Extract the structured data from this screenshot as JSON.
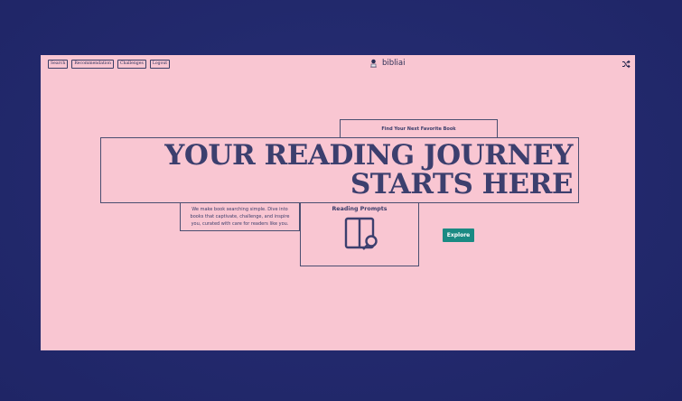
{
  "nav": {
    "items": [
      {
        "label": "Search"
      },
      {
        "label": "Recommendation"
      },
      {
        "label": "Challenges"
      },
      {
        "label": "Logout"
      }
    ]
  },
  "brand": {
    "name": "bibliai",
    "logo_icon": "reader-avatar-icon"
  },
  "shuffle_icon": "shuffle-icon",
  "tagline": "Find Your Next Favorite Book",
  "hero": {
    "line1": "YOUR READING JOURNEY",
    "line2": "STARTS HERE"
  },
  "description": "We make book searching simple. Dive into books that captivate, challenge, and inspire you, curated with care for readers like you.",
  "prompts": {
    "title": "Reading Prompts",
    "icon": "book-search-icon"
  },
  "explore_label": "Explore",
  "colors": {
    "background": "#232a6e",
    "panel": "#f9c6d2",
    "text": "#3c3f6e",
    "accent": "#1a8a83"
  }
}
